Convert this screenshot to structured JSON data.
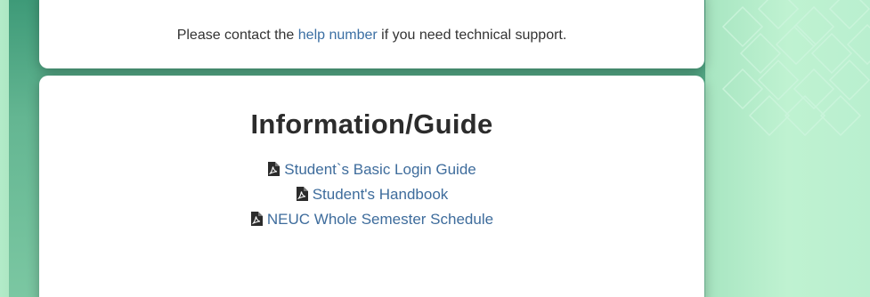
{
  "support": {
    "prefix": "Please contact the ",
    "link_text": "help number",
    "suffix": " if you need technical support."
  },
  "info": {
    "title": "Information/Guide",
    "links": [
      {
        "label": "Student`s Basic Login Guide",
        "icon": "pdf-file-icon"
      },
      {
        "label": "Student's Handbook",
        "icon": "pdf-file-icon"
      },
      {
        "label": "NEUC Whole Semester Schedule",
        "icon": "pdf-file-icon"
      }
    ]
  },
  "colors": {
    "link": "#3e6c9c",
    "text": "#333333",
    "title": "#2c2c2c",
    "background_accent": "#b6eccb"
  }
}
